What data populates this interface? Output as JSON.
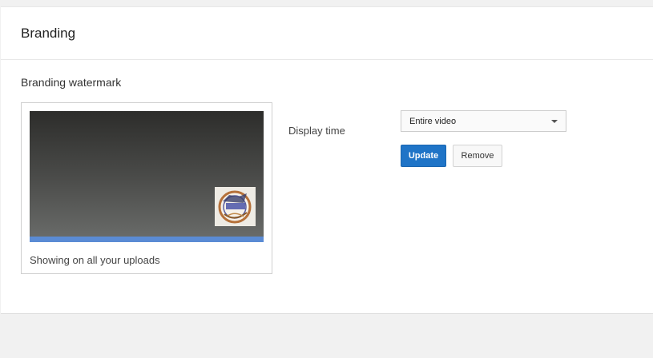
{
  "card": {
    "title": "Branding"
  },
  "watermark_section": {
    "title": "Branding watermark",
    "preview_caption": "Showing on all your uploads",
    "display_time_label": "Display time",
    "display_time_value": "Entire video",
    "update_label": "Update",
    "remove_label": "Remove"
  },
  "colors": {
    "accent": "#1f74c7",
    "progress": "#5a8bd4"
  }
}
